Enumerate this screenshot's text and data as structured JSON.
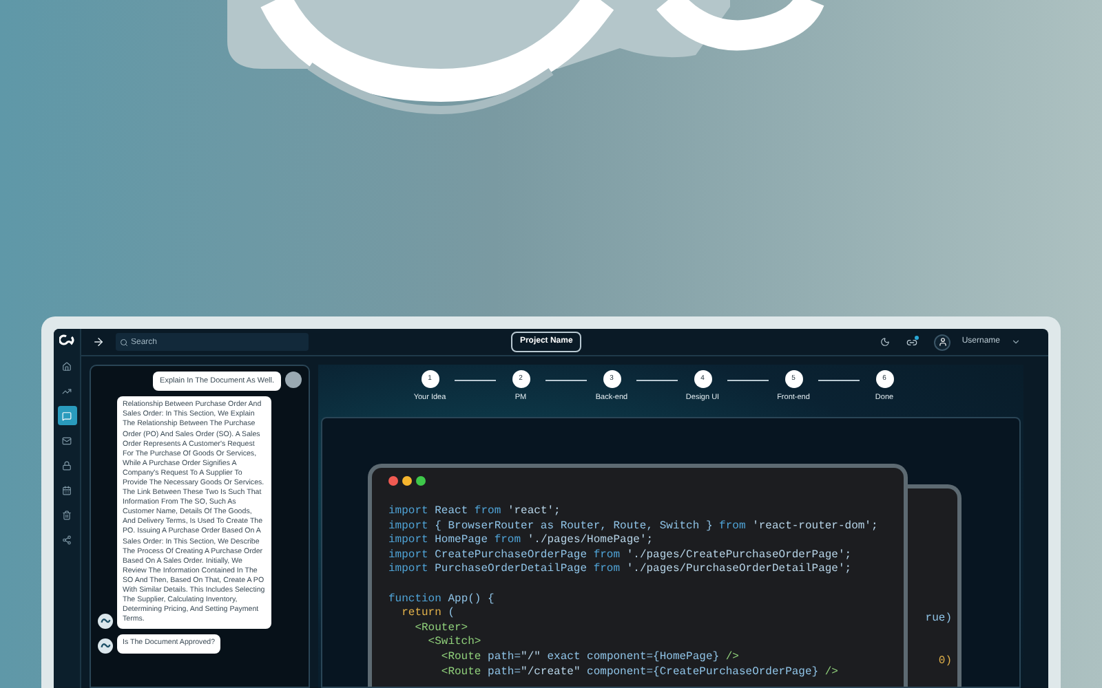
{
  "sidebar": {
    "items": [
      {
        "selected": false
      },
      {
        "selected": false
      },
      {
        "selected": true
      },
      {
        "selected": false
      },
      {
        "selected": false
      },
      {
        "selected": false
      },
      {
        "selected": false
      },
      {
        "selected": false
      }
    ]
  },
  "topbar": {
    "search": {
      "placeholder": "Search"
    },
    "project_button": "Project Name",
    "username": "Username",
    "notification": true
  },
  "chat": {
    "messages": [
      {
        "kind": "user",
        "text": "Explain In The Document As Well."
      },
      {
        "kind": "bot",
        "text": "Relationship Between Purchase Order And Sales Order: In This Section, We Explain The Relationship Between The Purchase Order (PO) And Sales Order (SO). A Sales Order Represents A Customer's Request For The Purchase Of Goods Or Services, While A Purchase Order Signifies A Company's Request To A Supplier To Provide The Necessary Goods Or Services. The Link Between These Two Is Such That Information From The SO, Such As Customer Name, Details Of The Goods, And Delivery Terms, Is Used To Create The PO. Issuing A Purchase Order Based On A Sales Order: In This Section, We Describe The Process Of Creating A Purchase Order Based On A Sales Order. Initially, We Review The Information Contained In The SO And Then, Based On That, Create A PO With Similar Details. This Includes Selecting The Supplier, Calculating Inventory, Determining Pricing, And Setting Payment Terms."
      },
      {
        "kind": "bot",
        "text": "Is The Document Approved?"
      }
    ]
  },
  "stepper": [
    {
      "number": "1",
      "label": "Your Idea"
    },
    {
      "number": "2",
      "label": "PM"
    },
    {
      "number": "3",
      "label": "Back-end"
    },
    {
      "number": "4",
      "label": "Design UI"
    },
    {
      "number": "5",
      "label": "Front-end"
    },
    {
      "number": "6",
      "label": "Done"
    }
  ],
  "code_window": {
    "lines": [
      {
        "spaced": false,
        "tokens": [
          {
            "kind": "kw",
            "text": "import "
          },
          {
            "kind": "name",
            "text": "React "
          },
          {
            "kind": "kw",
            "text": "from "
          },
          {
            "kind": "str",
            "text": "'react';"
          }
        ]
      },
      {
        "spaced": false,
        "tokens": [
          {
            "kind": "kw",
            "text": "import "
          },
          {
            "kind": "name",
            "text": "{ BrowserRouter as Router, Route, Switch } "
          },
          {
            "kind": "kw",
            "text": "from "
          },
          {
            "kind": "str",
            "text": "'react-router-dom';"
          }
        ]
      },
      {
        "spaced": false,
        "tokens": [
          {
            "kind": "kw",
            "text": "import "
          },
          {
            "kind": "name",
            "text": "HomePage "
          },
          {
            "kind": "kw",
            "text": "from "
          },
          {
            "kind": "str",
            "text": "'./pages/HomePage';"
          }
        ]
      },
      {
        "spaced": false,
        "tokens": [
          {
            "kind": "kw",
            "text": "import "
          },
          {
            "kind": "name",
            "text": "CreatePurchaseOrderPage "
          },
          {
            "kind": "kw",
            "text": "from "
          },
          {
            "kind": "str",
            "text": "'./pages/CreatePurchaseOrderPage';"
          }
        ]
      },
      {
        "spaced": false,
        "tokens": [
          {
            "kind": "kw",
            "text": "import "
          },
          {
            "kind": "name",
            "text": "PurchaseOrderDetailPage "
          },
          {
            "kind": "kw",
            "text": "from "
          },
          {
            "kind": "str",
            "text": "'./pages/PurchaseOrderDetailPage';"
          }
        ]
      },
      {
        "spaced": true,
        "tokens": [
          {
            "kind": "kw",
            "text": "function "
          },
          {
            "kind": "name",
            "text": "App() {"
          }
        ]
      },
      {
        "spaced": false,
        "tokens": [
          {
            "kind": "ret",
            "text": "  return "
          },
          {
            "kind": "name",
            "text": "("
          }
        ]
      },
      {
        "spaced": false,
        "tokens": [
          {
            "kind": "tag",
            "text": "    <Router>"
          }
        ]
      },
      {
        "spaced": false,
        "tokens": [
          {
            "kind": "tag",
            "text": "      <Switch>"
          }
        ]
      },
      {
        "spaced": false,
        "tokens": [
          {
            "kind": "tag",
            "text": "        <Route "
          },
          {
            "kind": "name",
            "text": "path="
          },
          {
            "kind": "str",
            "text": "\"/\" "
          },
          {
            "kind": "name",
            "text": "exact component={HomePage} "
          },
          {
            "kind": "tag",
            "text": "/>"
          }
        ]
      },
      {
        "spaced": false,
        "tokens": [
          {
            "kind": "tag",
            "text": "        <Route "
          },
          {
            "kind": "name",
            "text": "path="
          },
          {
            "kind": "str",
            "text": "\"/create\" "
          },
          {
            "kind": "name",
            "text": "component={CreatePurchaseOrderPage} "
          },
          {
            "kind": "tag",
            "text": "/>"
          }
        ]
      }
    ]
  },
  "back_window": {
    "fragments": [
      {
        "kind": "name",
        "text": "rue)"
      },
      {
        "kind": "ret",
        "text": "0)"
      }
    ]
  }
}
